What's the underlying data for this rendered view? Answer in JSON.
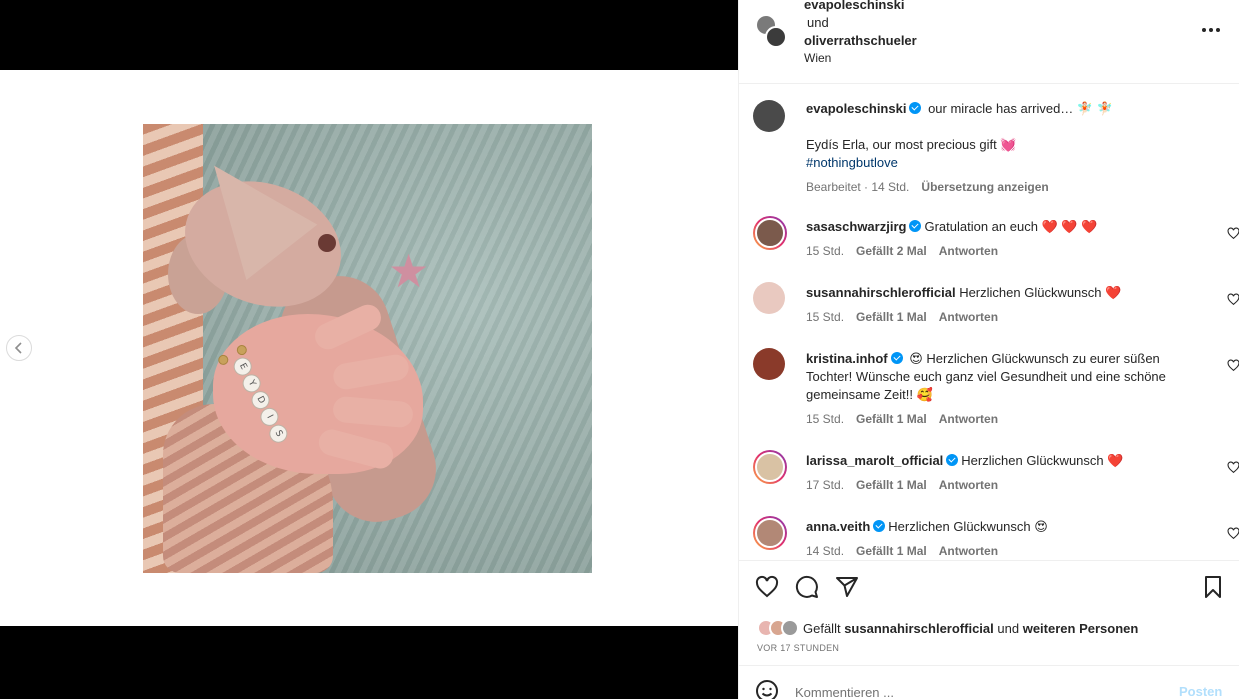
{
  "header": {
    "user1": "evapoleschinski",
    "and": "und",
    "user2": "oliverrathschueler",
    "location": "Wien"
  },
  "caption": {
    "user": "evapoleschinski",
    "line1": "our miracle has arrived… 🧚🏻 🧚🏻",
    "line2": "Eydís Erla, our most precious gift 💓",
    "hashtag": "#nothingbutlove",
    "edited": "Bearbeitet · 14 Std.",
    "translate": "Übersetzung anzeigen"
  },
  "comments": [
    {
      "user": "sasaschwarzjirg",
      "text": "Gratulation an euch ❤️ ❤️ ❤️",
      "time": "15 Std.",
      "likes": "Gefällt 2 Mal",
      "reply": "Antworten",
      "verified": true
    },
    {
      "user": "susannahirschlerofficial",
      "text": "Herzlichen Glückwunsch ❤️",
      "time": "15 Std.",
      "likes": "Gefällt 1 Mal",
      "reply": "Antworten",
      "verified": false
    },
    {
      "user": "kristina.inhof",
      "text": "😍 Herzlichen Glückwunsch zu eurer süßen Tochter! Wünsche euch ganz viel Gesundheit und eine schöne gemeinsame Zeit!! 🥰",
      "time": "15 Std.",
      "likes": "Gefällt 1 Mal",
      "reply": "Antworten",
      "verified": true
    },
    {
      "user": "larissa_marolt_official",
      "text": "Herzlichen Glückwunsch ❤️",
      "time": "17 Std.",
      "likes": "Gefällt 1 Mal",
      "reply": "Antworten",
      "verified": true
    },
    {
      "user": "anna.veith",
      "text": "Herzlichen Glückwunsch 😍",
      "time": "14 Std.",
      "likes": "Gefällt 1 Mal",
      "reply": "Antworten",
      "verified": true
    }
  ],
  "likes_bar": {
    "prefix": "Gefällt",
    "user": "susannahirschlerofficial",
    "middle": "und",
    "others": "weiteren Personen",
    "timeago": "VOR 17 STUNDEN"
  },
  "composer": {
    "placeholder": "Kommentieren ...",
    "post": "Posten"
  },
  "photo": {
    "bracelet_letters": [
      "E",
      "Y",
      "D",
      "I",
      "S"
    ]
  },
  "icons": [
    "chevron-left-icon",
    "more-icon",
    "heart-icon",
    "comment-icon",
    "share-icon",
    "bookmark-icon",
    "emoji-icon",
    "verified-icon"
  ],
  "colors": {
    "verified": "#0095f6",
    "link": "#00376b",
    "post_disabled": "#b2dffc",
    "muted": "#737373"
  }
}
